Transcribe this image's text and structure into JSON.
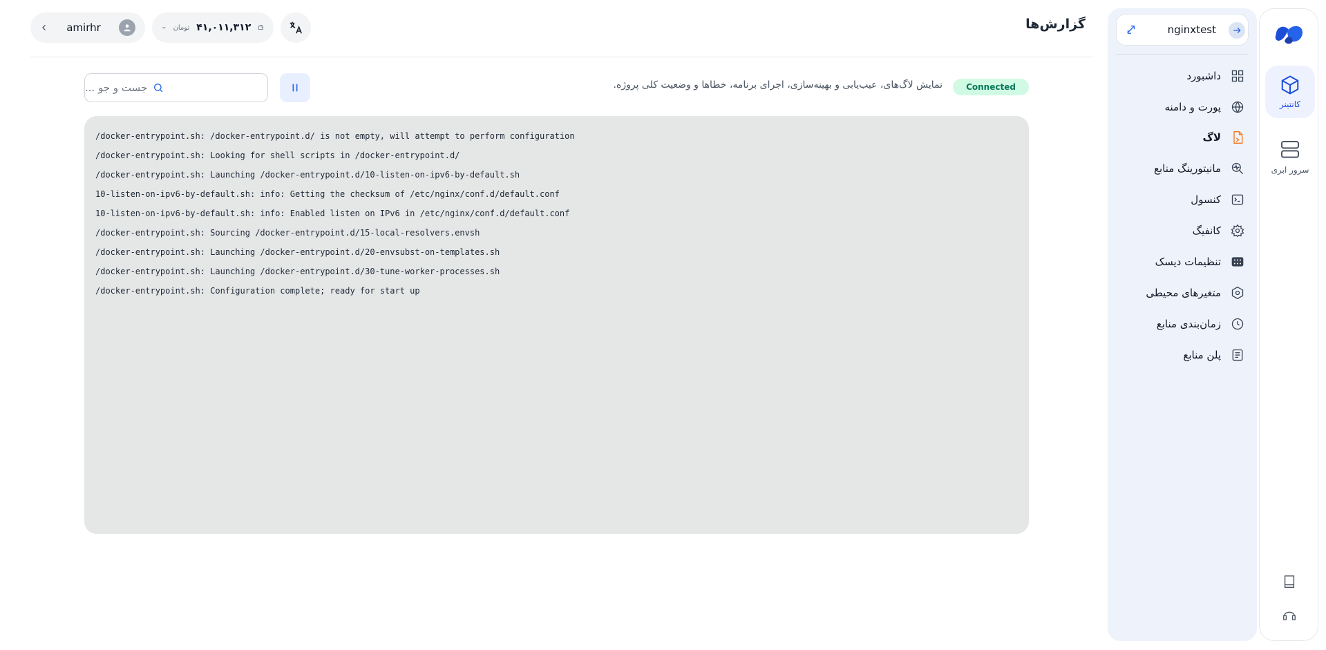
{
  "rail": {
    "items": [
      {
        "label": "کانتینر",
        "icon": "cube-icon",
        "active": true
      },
      {
        "label": "سرور ابری",
        "icon": "server-icon",
        "active": false
      }
    ],
    "bottom_icons": [
      "book-icon",
      "headset-icon"
    ]
  },
  "sidebar": {
    "app_name": "nginxtest",
    "items": [
      {
        "label": "داشبورد",
        "icon": "grid-icon"
      },
      {
        "label": "پورت و دامنه",
        "icon": "globe-icon"
      },
      {
        "label": "لاگ",
        "icon": "log-file-icon",
        "active": true
      },
      {
        "label": "مانیتورینگ منابع",
        "icon": "monitor-search-icon"
      },
      {
        "label": "کنسول",
        "icon": "terminal-icon"
      },
      {
        "label": "کانفیگ",
        "icon": "gear-icon"
      },
      {
        "label": "تنظیمات دیسک",
        "icon": "disk-icon"
      },
      {
        "label": "متغیرهای محیطی",
        "icon": "hexagon-icon"
      },
      {
        "label": "زمان‌بندی منابع",
        "icon": "clock-icon"
      },
      {
        "label": "پلن منابع",
        "icon": "plan-list-icon"
      }
    ]
  },
  "header": {
    "title": "گزارش‌ها",
    "username": "amirhr",
    "balance": "۴۱,۰۱۱,۳۱۲",
    "currency": "تومان"
  },
  "logs": {
    "status": "Connected",
    "description": "نمایش لاگ‌های، عیب‌یابی و بهینه‌سازی، اجرای برنامه، خطاها و وضعیت کلی پروژه.",
    "search_placeholder": "جست و جو ...",
    "lines": [
      "/docker-entrypoint.sh: /docker-entrypoint.d/ is not empty, will attempt to perform configuration",
      "/docker-entrypoint.sh: Looking for shell scripts in /docker-entrypoint.d/",
      "/docker-entrypoint.sh: Launching /docker-entrypoint.d/10-listen-on-ipv6-by-default.sh",
      "10-listen-on-ipv6-by-default.sh: info: Getting the checksum of /etc/nginx/conf.d/default.conf",
      "10-listen-on-ipv6-by-default.sh: info: Enabled listen on IPv6 in /etc/nginx/conf.d/default.conf",
      "/docker-entrypoint.sh: Sourcing /docker-entrypoint.d/15-local-resolvers.envsh",
      "/docker-entrypoint.sh: Launching /docker-entrypoint.d/20-envsubst-on-templates.sh",
      "/docker-entrypoint.sh: Launching /docker-entrypoint.d/30-tune-worker-processes.sh",
      "/docker-entrypoint.sh: Configuration complete; ready for start up"
    ]
  },
  "colors": {
    "accent": "#2563eb",
    "active_menu_icon": "#f97316",
    "status_bg": "#d1fae5",
    "status_text": "#047857"
  }
}
